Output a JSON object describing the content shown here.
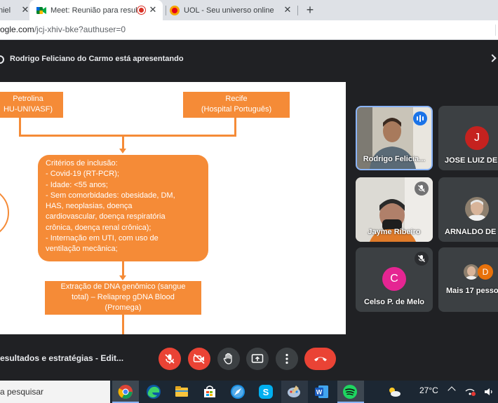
{
  "browser": {
    "tabs": [
      {
        "title": "niel",
        "icon": "document-icon"
      },
      {
        "title": "Meet: Reunião para resultado",
        "icon": "meet-icon",
        "recording": true,
        "active": true
      },
      {
        "title": "UOL - Seu universo online",
        "icon": "uol-icon"
      }
    ],
    "close_glyph": "✕",
    "new_tab_glyph": "+",
    "url_host": "ogle.com",
    "url_path": "/jcj-xhiv-bke?authuser=0"
  },
  "meet": {
    "presenting_text": "Rodrigo Feliciano do Carmo está apresentando",
    "meeting_title": "esultados e estratégias - Edit...",
    "participants": [
      {
        "name": "Rodrigo Felicia...",
        "type": "video",
        "speaking": true
      },
      {
        "name": "JOSE LUIZ DE",
        "type": "avatar",
        "initial": "J",
        "color": "#c5221f"
      },
      {
        "name": "Jayme Ribeiro",
        "type": "video",
        "muted": true
      },
      {
        "name": "ARNALDO DE",
        "type": "photo"
      },
      {
        "name": "Celso P. de Melo",
        "type": "avatar",
        "initial": "C",
        "color": "#e52592",
        "muted": true
      },
      {
        "name": "Mais 17 pesso",
        "type": "group",
        "initial": "D",
        "color": "#e8710a"
      }
    ],
    "controls": [
      "mic-off",
      "camera-off",
      "raise-hand",
      "present",
      "more-options",
      "end-call"
    ]
  },
  "slide": {
    "petrolina": {
      "line1": "Petrolina",
      "line2": "HU-UNIVASF)"
    },
    "recife": {
      "line1": "Recife",
      "line2": "(Hospital Português)"
    },
    "criteria": [
      "Critérios de inclusão:",
      "-    Covid-19 (RT-PCR);",
      "-    Idade: <55 anos;",
      "-    Sem comorbidades: obesidade, DM,",
      "      HAS, neoplasias, doença",
      "      cardiovascular, doença respiratória",
      "      crônica, doença renal crônica);",
      "-    Internação em UTI, com uso de",
      "      ventilação mecânica;"
    ],
    "dna": {
      "line1": "Extração de DNA genômico (sangue",
      "line2": "total) – Reliaprep gDNA Blood",
      "line3": "(Promega)"
    }
  },
  "taskbar": {
    "search_placeholder": "a pesquisar",
    "apps": [
      "chrome-icon",
      "edge-icon",
      "file-explorer-icon",
      "store-icon",
      "safari-icon",
      "skype-icon",
      "paint-icon",
      "word-icon",
      "spotify-icon"
    ],
    "temperature": "27°C"
  },
  "colors": {
    "slide_orange": "#f58b37",
    "meet_bg": "#202124",
    "tile_bg": "#3c4043",
    "end_call": "#ea4335"
  }
}
